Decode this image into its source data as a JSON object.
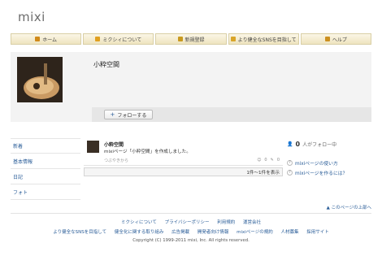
{
  "header": {
    "logo": "mixi"
  },
  "topnav": [
    {
      "label": "ホーム",
      "icon": "home-icon",
      "color": "#d08a1a"
    },
    {
      "label": "ミクシィについて",
      "icon": "info-icon",
      "color": "#e0a020"
    },
    {
      "label": "新規登録",
      "icon": "register-icon",
      "color": "#c99a20"
    },
    {
      "label": "より健全なSNSを目指して",
      "icon": "sns-icon",
      "color": "#d9a52a"
    },
    {
      "label": "ヘルプ",
      "icon": "help-icon",
      "color": "#cc9020"
    }
  ],
  "profile": {
    "name": "小粋空間",
    "follow_label": "フォローする",
    "follow_icon": "plus-icon"
  },
  "sidemenu": [
    "新着",
    "基本情報",
    "日記",
    "フォト"
  ],
  "feed": {
    "post": {
      "author": "小粋空間",
      "text": "mixiページ「小粋空間」を作成しました。",
      "meta": "つぶやきから",
      "actions": [
        "0",
        "0"
      ]
    },
    "pager": "1件～1件を表示"
  },
  "right": {
    "follower_count": "0",
    "follower_label": "人がフォロー中",
    "links": [
      "mixiページの使い方",
      "mixiページを作るには？"
    ]
  },
  "page_top": "このページの上部へ",
  "footer": {
    "links1": [
      "ミクシィについて",
      "プライバシーポリシー",
      "利用規約",
      "運営会社"
    ],
    "links2": [
      "より健全なSNSを目指して",
      "健全化に関する取り組み",
      "広告掲載",
      "開発者向け情報",
      "mixiページの規約",
      "人材募集",
      "採用サイト"
    ],
    "copyright": "Copyright (C) 1999-2011 mixi, Inc. All rights reserved."
  }
}
